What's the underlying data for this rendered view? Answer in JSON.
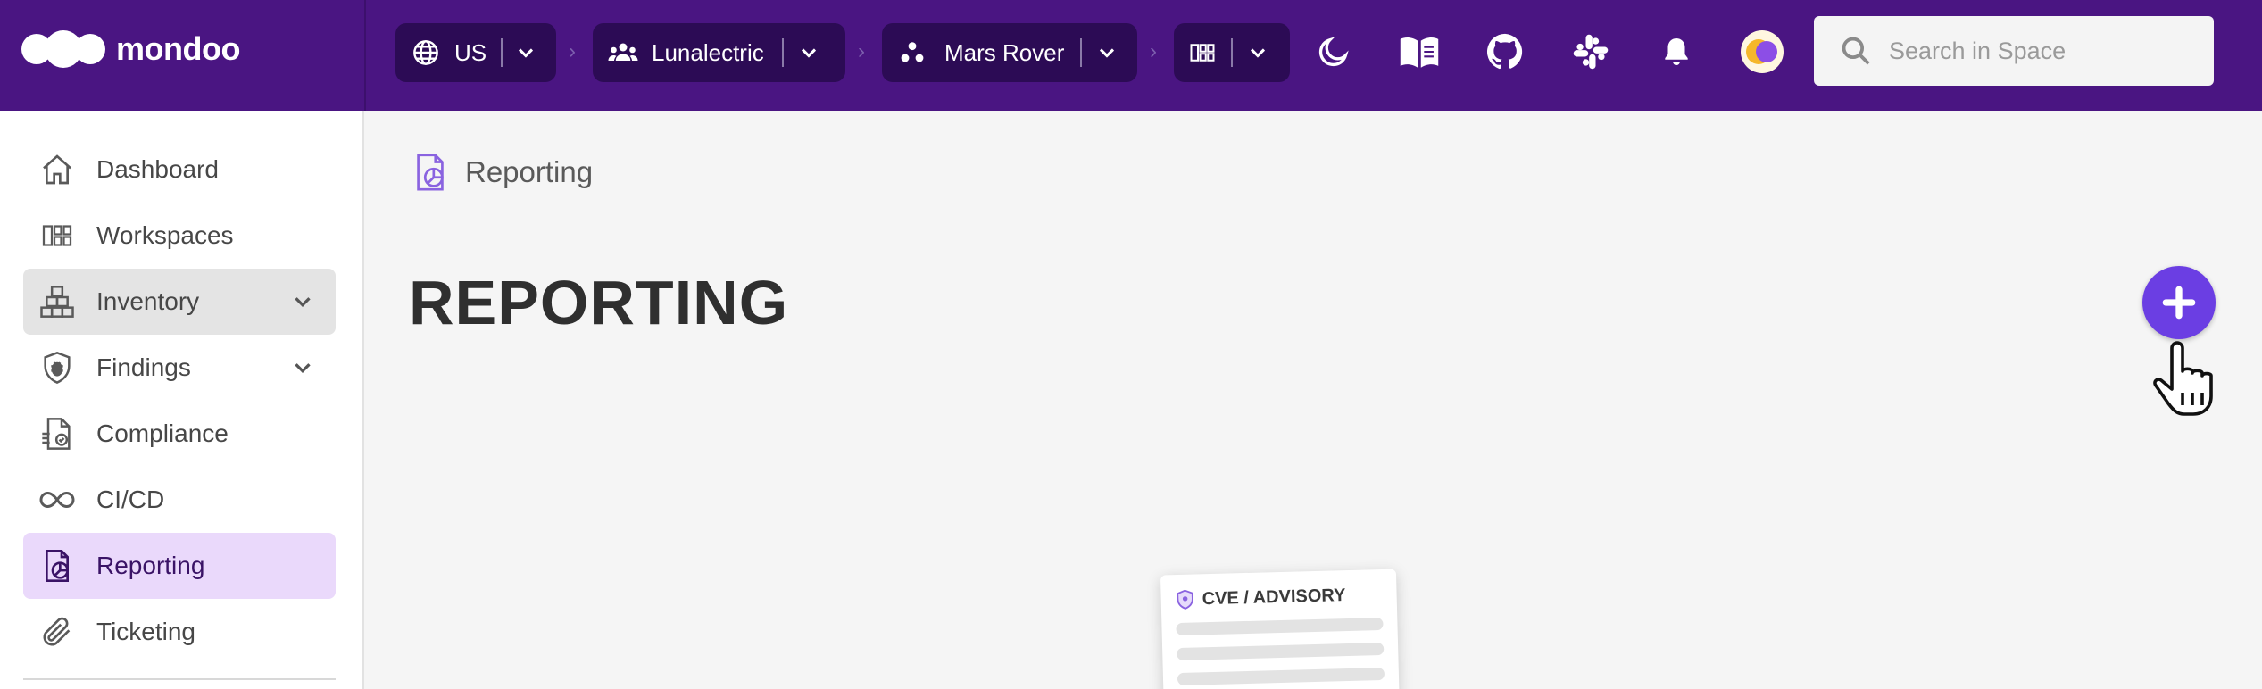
{
  "app": {
    "logo_text": "mondoo"
  },
  "topbar": {
    "region": {
      "label": "US",
      "icon": "globe-icon"
    },
    "organization": {
      "label": "Lunalectric",
      "icon": "group-icon"
    },
    "space": {
      "label": "Mars Rover",
      "icon": "space-icon"
    },
    "workspace": {
      "icon": "workspaces-icon"
    },
    "actions": [
      "dark-mode-icon",
      "docs-book-icon",
      "github-icon",
      "slack-icon",
      "notifications-bell-icon",
      "user-avatar"
    ],
    "search": {
      "placeholder": "Search in Space",
      "value": ""
    },
    "colors": {
      "bar": "#4a1582",
      "crumb": "#2c0b55"
    }
  },
  "sidebar": {
    "items": [
      {
        "label": "Dashboard",
        "icon": "home-icon"
      },
      {
        "label": "Workspaces",
        "icon": "workspaces-icon"
      },
      {
        "label": "Inventory",
        "icon": "inventory-boxes-icon",
        "expandable": true,
        "state": "expanded"
      },
      {
        "label": "Findings",
        "icon": "findings-shield-bug-icon",
        "expandable": true
      },
      {
        "label": "Compliance",
        "icon": "compliance-document-check-icon"
      },
      {
        "label": "CI/CD",
        "icon": "infinity-icon"
      },
      {
        "label": "Reporting",
        "icon": "reporting-document-icon",
        "state": "active"
      },
      {
        "label": "Ticketing",
        "icon": "paperclip-icon"
      }
    ]
  },
  "main": {
    "breadcrumb": {
      "label": "Reporting",
      "icon": "reporting-document-icon"
    },
    "title": "REPORTING",
    "add_button": {
      "icon": "plus-icon",
      "color": "#6b3ee3"
    },
    "empty_state_card": {
      "title": "CVE / ADVISORY",
      "icon": "shield-icon"
    }
  }
}
